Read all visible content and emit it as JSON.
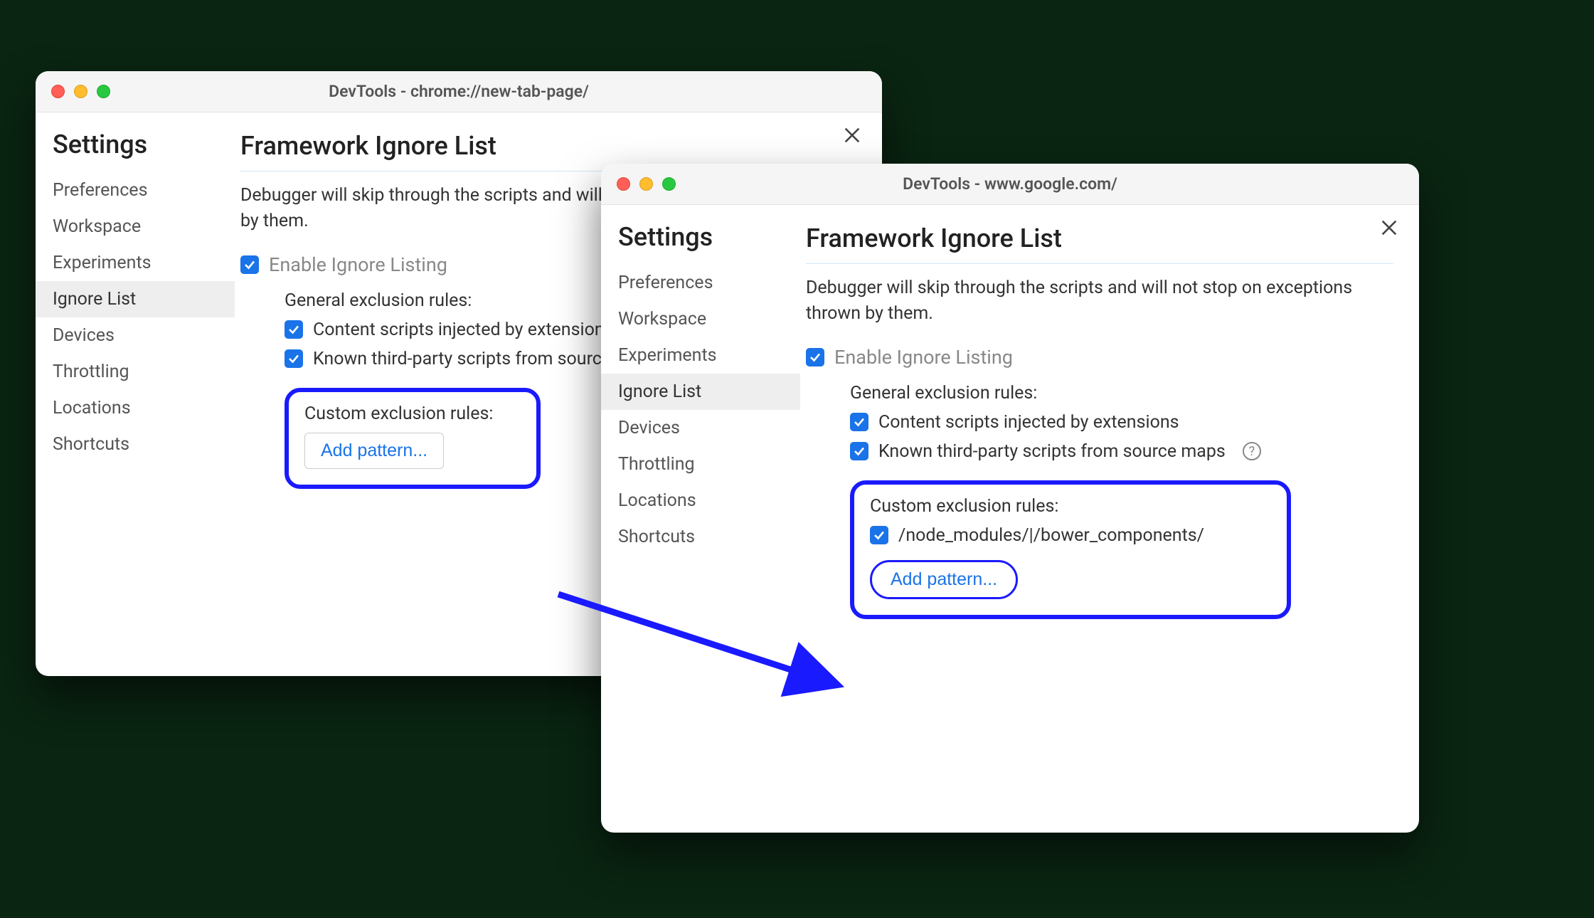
{
  "window1": {
    "title": "DevTools - chrome://new-tab-page/",
    "sidebar_heading": "Settings",
    "nav": [
      "Preferences",
      "Workspace",
      "Experiments",
      "Ignore List",
      "Devices",
      "Throttling",
      "Locations",
      "Shortcuts"
    ],
    "active_nav_index": 3,
    "content_heading": "Framework Ignore List",
    "description": "Debugger will skip through the scripts and will not stop on exceptions thrown by them.",
    "enable_label": "Enable Ignore Listing",
    "general_rules_title": "General exclusion rules:",
    "rule1": "Content scripts injected by extensions",
    "rule2": "Known third-party scripts from source maps",
    "custom_rules_title": "Custom exclusion rules:",
    "add_pattern_label": "Add pattern..."
  },
  "window2": {
    "title": "DevTools - www.google.com/",
    "sidebar_heading": "Settings",
    "nav": [
      "Preferences",
      "Workspace",
      "Experiments",
      "Ignore List",
      "Devices",
      "Throttling",
      "Locations",
      "Shortcuts"
    ],
    "active_nav_index": 3,
    "content_heading": "Framework Ignore List",
    "description": "Debugger will skip through the scripts and will not stop on exceptions thrown by them.",
    "enable_label": "Enable Ignore Listing",
    "general_rules_title": "General exclusion rules:",
    "rule1": "Content scripts injected by extensions",
    "rule2": "Known third-party scripts from source maps",
    "custom_rules_title": "Custom exclusion rules:",
    "custom_pattern": "/node_modules/|/bower_components/",
    "add_pattern_label": "Add pattern..."
  }
}
